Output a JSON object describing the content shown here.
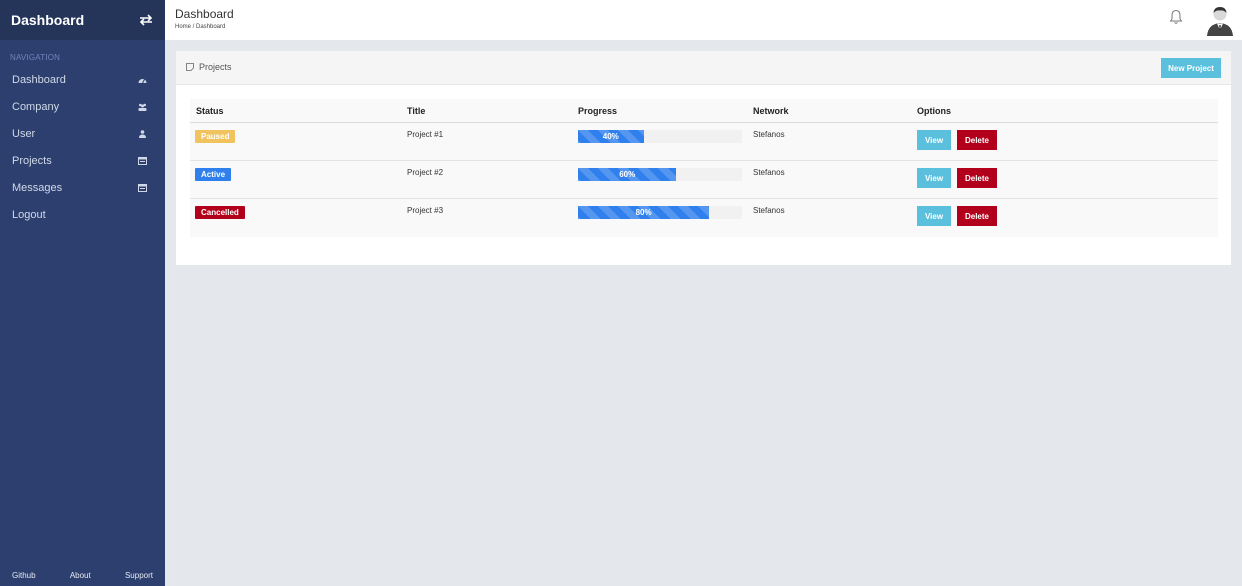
{
  "sidebar": {
    "brand": "Dashboard",
    "nav_heading": "NAVIGATION",
    "items": [
      {
        "label": "Dashboard",
        "icon": "dashboard-icon"
      },
      {
        "label": "Company",
        "icon": "users-icon"
      },
      {
        "label": "User",
        "icon": "user-icon"
      },
      {
        "label": "Projects",
        "icon": "list-icon"
      },
      {
        "label": "Messages",
        "icon": "message-icon"
      },
      {
        "label": "Logout",
        "icon": ""
      }
    ],
    "footer": [
      "Github",
      "About",
      "Support"
    ]
  },
  "header": {
    "title": "Dashboard",
    "breadcrumb": "Home / Dashboard"
  },
  "card": {
    "title": "Projects",
    "new_project_label": "New Project",
    "columns": [
      "Status",
      "Title",
      "Progress",
      "Network",
      "Options"
    ],
    "rows": [
      {
        "status": "Paused",
        "status_color": "#f0c35e",
        "title": "Project #1",
        "progress": 40,
        "progress_label": "40%",
        "network": "Stefanos",
        "view": "View",
        "delete": "Delete"
      },
      {
        "status": "Active",
        "status_color": "#2f80ed",
        "title": "Project #2",
        "progress": 60,
        "progress_label": "60%",
        "network": "Stefanos",
        "view": "View",
        "delete": "Delete"
      },
      {
        "status": "Cancelled",
        "status_color": "#b2001c",
        "title": "Project #3",
        "progress": 80,
        "progress_label": "80%",
        "network": "Stefanos",
        "view": "View",
        "delete": "Delete"
      }
    ]
  },
  "colors": {
    "sidebar_bg": "#2c3f6e",
    "brand_bg": "#243559",
    "accent_info": "#5bc0de",
    "danger": "#b2001c",
    "progress": "#2f80ed"
  }
}
